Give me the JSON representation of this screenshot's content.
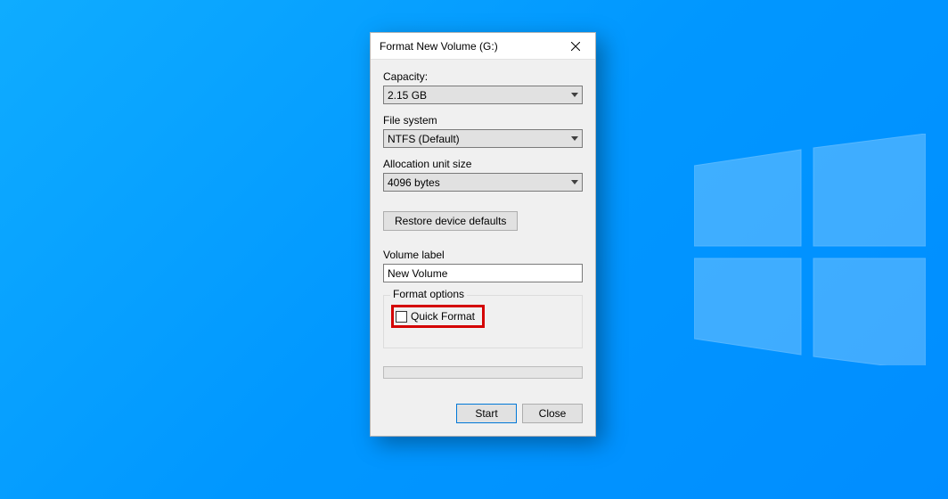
{
  "dialog": {
    "title": "Format New Volume (G:)",
    "capacity_label": "Capacity:",
    "capacity_value": "2.15 GB",
    "filesystem_label": "File system",
    "filesystem_value": "NTFS (Default)",
    "allocation_label": "Allocation unit size",
    "allocation_value": "4096 bytes",
    "restore_label": "Restore device defaults",
    "volume_label": "Volume label",
    "volume_value": "New Volume",
    "format_options_label": "Format options",
    "quick_format_label": "Quick Format",
    "quick_format_checked": false,
    "start_label": "Start",
    "close_label": "Close"
  }
}
